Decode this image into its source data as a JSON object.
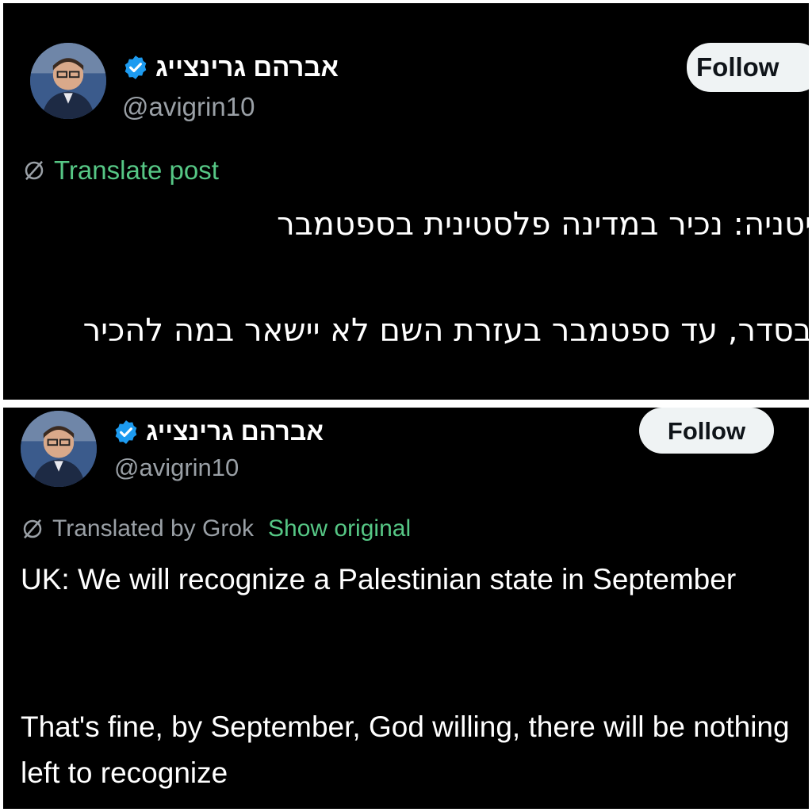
{
  "top_post": {
    "display_name": "אברהם גרינצייג",
    "handle": "@avigrin10",
    "follow_label": "Follow",
    "translate_label": "Translate post",
    "line_1": "יטניה: נכיר במדינה פלסטינית בספטמבר",
    "line_2": "בסדר, עד ספטמבר בעזרת השם לא יישאר במה להכיר"
  },
  "bottom_post": {
    "display_name": "אברהם גרינצייג",
    "handle": "@avigrin10",
    "follow_label": "Follow",
    "translated_by": "Translated by Grok",
    "show_original": "Show original",
    "paragraph_1": "UK: We will recognize a Palestinian state in September",
    "paragraph_2": "That's fine, by September, God willing, there will be nothing left to recognize"
  },
  "colors": {
    "background": "#000000",
    "link": "#56c785",
    "verified": "#1d9bf0",
    "muted": "#9aa0a6"
  },
  "icons": [
    "verified-badge-icon",
    "translate-globe-icon",
    "avatar"
  ]
}
